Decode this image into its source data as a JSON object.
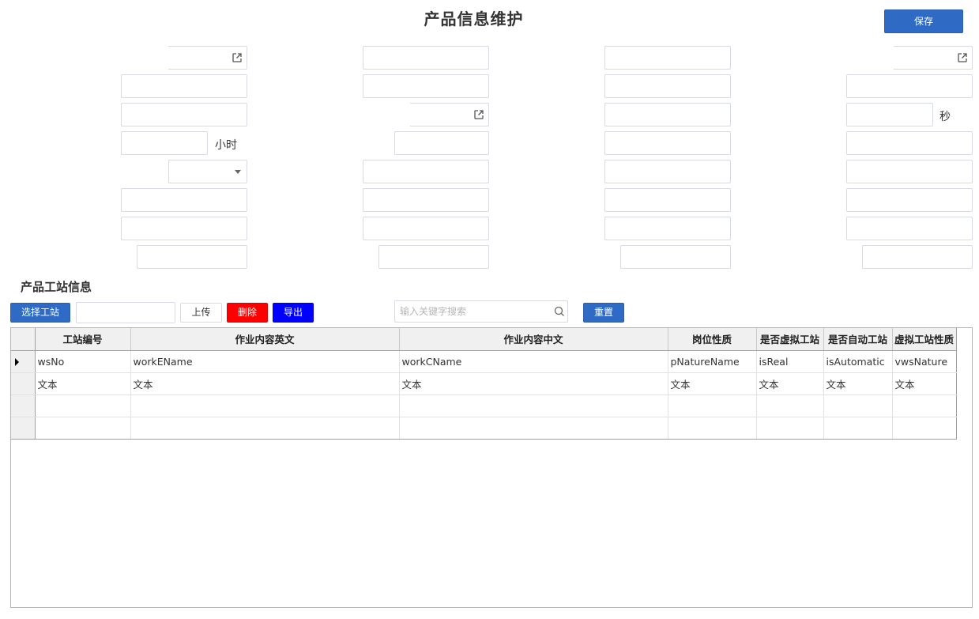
{
  "page": {
    "title": "产品信息维护",
    "save_label": "保存"
  },
  "units": {
    "seconds": "秒",
    "hours": "小时"
  },
  "section": {
    "title": "产品工站信息",
    "select_station_label": "选择工站",
    "upload_label": "上传",
    "delete_label": "删除",
    "export_label": "导出",
    "search_placeholder": "输入关键字搜索",
    "reset_label": "重置"
  },
  "grid": {
    "columns": [
      "工站编号",
      "作业内容英文",
      "作业内容中文",
      "岗位性质",
      "是否虚拟工站",
      "是否自动工站",
      "虚拟工站性质"
    ],
    "rows": [
      [
        "wsNo",
        "workEName",
        "workCName",
        "pNatureName",
        "isReal",
        "isAutomatic",
        "vwsNature"
      ],
      [
        "文本",
        "文本",
        "文本",
        "文本",
        "文本",
        "文本",
        "文本"
      ],
      [
        "",
        "",
        "",
        "",
        "",
        "",
        ""
      ],
      [
        "",
        "",
        "",
        "",
        "",
        "",
        ""
      ]
    ]
  },
  "colors": {
    "primary": "#2f6bc4",
    "danger": "#ff0000",
    "export": "#0000ff",
    "border": "#d9dbe3"
  }
}
